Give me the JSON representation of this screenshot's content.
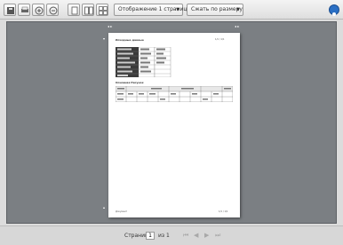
{
  "toolbar": {
    "view_mode_label": "Отображение 1 страницы",
    "zoom_label": "Сжать по размеру",
    "icons": [
      "save-icon",
      "print-icon",
      "zoom-in-icon",
      "zoom-out-icon",
      "single-page-icon",
      "two-page-icon",
      "multi-page-icon"
    ]
  },
  "document": {
    "heading": "Исходные данные",
    "page_header_right": "1/1 / 1/1",
    "section2_heading": "Основная Рисунок",
    "footer_left": "Документ",
    "footer_right": "1/1 / 1/1"
  },
  "statusbar": {
    "page_label": "Страница",
    "page_value": "1",
    "of_label": "из 1"
  },
  "colors": {
    "viewer_bg": "#7b7f83",
    "table_header_dark": "#3a3a3a",
    "help_blue": "#2a6fc4"
  }
}
